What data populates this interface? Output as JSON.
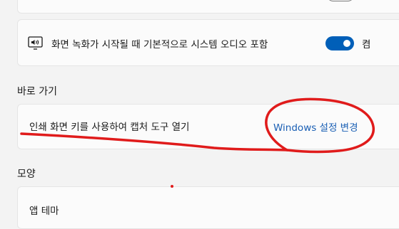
{
  "audio_row": {
    "label": "화면 녹화가 시작될 때 기본적으로 시스템 오디오 포함",
    "toggle_on": true,
    "toggle_state": "켬"
  },
  "shortcut_section": {
    "title": "바로 가기",
    "print_screen_label": "인쇄 화면 키를 사용하여 캡처 도구 열기",
    "link_label": "Windows 설정 변경"
  },
  "appearance_section": {
    "title": "모양",
    "theme_label": "앱 테마"
  },
  "colors": {
    "accent": "#005fb8",
    "link": "#1a5fb4",
    "annotation": "#e01b1b"
  }
}
